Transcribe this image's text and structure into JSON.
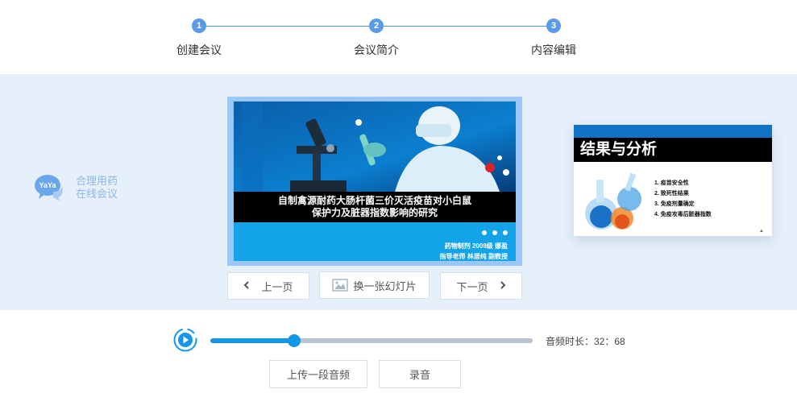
{
  "stepper": {
    "steps": [
      {
        "number": "1",
        "label": "创建会议"
      },
      {
        "number": "2",
        "label": "会议简介"
      },
      {
        "number": "3",
        "label": "内容编辑"
      }
    ]
  },
  "brand": {
    "logo_text": "YaYa",
    "line1": "合理用药",
    "line2": "在线会议"
  },
  "main_slide": {
    "title_line1": "自制禽源耐药大肠杆菌三价灭活疫苗对小白鼠",
    "title_line2": "保护力及脏器指数影响的研究",
    "author_line1": "药物制剂 2009级 娜盈",
    "author_line2": "指导老师 林居纯 副教授"
  },
  "buttons": {
    "prev": "上一页",
    "change": "换一张幻灯片",
    "next": "下一页",
    "upload": "上传一段音频",
    "record": "录音"
  },
  "preview_slide": {
    "title": "结果与分析",
    "items": [
      "1. 疫苗安全性",
      "2. 致死性结果",
      "3. 免疫剂量确定",
      "4. 免疫攻毒后脏器指数"
    ],
    "mark": "▲"
  },
  "audio": {
    "progress": 0.26,
    "duration_text": "音频时长：32：68"
  },
  "colors": {
    "accent": "#1596e8",
    "band_bg": "#e6f0fb",
    "step_dot": "#5a9ae6"
  }
}
